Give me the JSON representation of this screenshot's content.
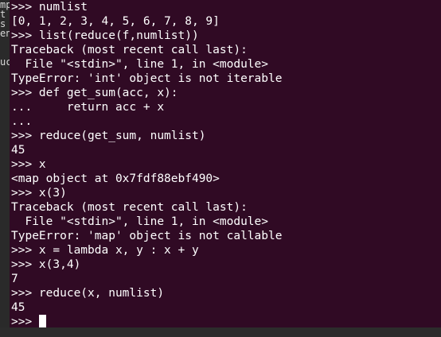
{
  "background_window": {
    "fragments": [
      "mp",
      "t",
      "s",
      "en",
      "uc"
    ]
  },
  "terminal": {
    "colors": {
      "background": "#300a24",
      "foreground": "#ffffff"
    },
    "lines": [
      ">>> numlist",
      "[0, 1, 2, 3, 4, 5, 6, 7, 8, 9]",
      ">>> list(reduce(f,numlist))",
      "Traceback (most recent call last):",
      "  File \"<stdin>\", line 1, in <module>",
      "TypeError: 'int' object is not iterable",
      ">>> def get_sum(acc, x):",
      "...     return acc + x",
      "...",
      ">>> reduce(get_sum, numlist)",
      "45",
      ">>> x",
      "<map object at 0x7fdf88ebf490>",
      ">>> x(3)",
      "Traceback (most recent call last):",
      "  File \"<stdin>\", line 1, in <module>",
      "TypeError: 'map' object is not callable",
      ">>> x = lambda x, y : x + y",
      ">>> x(3,4)",
      "7",
      ">>> reduce(x, numlist)",
      "45"
    ],
    "prompt": ">>> "
  }
}
